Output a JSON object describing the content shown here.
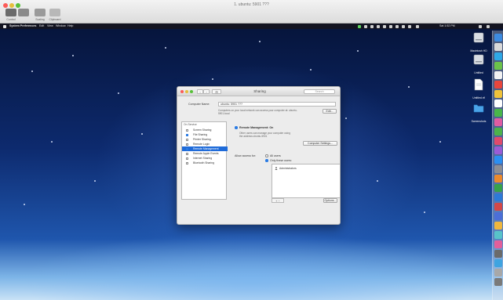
{
  "viewer": {
    "title": "1. ubuntu: 5901 ???",
    "toolbar": {
      "control_label": "Control",
      "scaling_label": "Scaling",
      "clipboard_label": "Clipboard"
    }
  },
  "menubar": {
    "app_name": "System Preferences",
    "menus": [
      "Edit",
      "View",
      "Window",
      "Help"
    ],
    "clock": "Sat 1:52 PM"
  },
  "desktop_items": [
    {
      "label": "Macintosh HD",
      "icon": "hard-drive-icon"
    },
    {
      "label": "Untitled",
      "icon": "hard-drive-icon"
    },
    {
      "label": "Untitled.rtf",
      "icon": "document-icon"
    },
    {
      "label": "Screenshots",
      "icon": "folder-icon"
    }
  ],
  "prefs": {
    "title": "Sharing",
    "search_placeholder": "Search",
    "computer_name_label": "Computer Name:",
    "computer_name_value": "ubuntu: 5901 ???",
    "computer_name_hint": "Computers on your local network can access your computer at: ubuntu-5901.local",
    "edit_button": "Edit...",
    "services_header": "On   Service",
    "services": [
      {
        "name": "Screen Sharing",
        "on": false,
        "selected": false
      },
      {
        "name": "File Sharing",
        "on": true,
        "selected": false
      },
      {
        "name": "Printer Sharing",
        "on": false,
        "selected": false
      },
      {
        "name": "Remote Login",
        "on": false,
        "selected": false
      },
      {
        "name": "Remote Management",
        "on": true,
        "selected": true
      },
      {
        "name": "Remote Apple Events",
        "on": false,
        "selected": false
      },
      {
        "name": "Internet Sharing",
        "on": false,
        "selected": false
      },
      {
        "name": "Bluetooth Sharing",
        "on": false,
        "selected": false
      }
    ],
    "status_title": "Remote Management: On",
    "status_desc": "Other users can manage your computer using the address ubuntu-5901",
    "computer_settings_button": "Computer Settings...",
    "allow_access_label": "Allow access for:",
    "all_users_label": "All users",
    "only_users_label": "Only these users:",
    "users": [
      "Administrators"
    ],
    "options_button": "Options...",
    "plus_minus": "+ −"
  },
  "colors": {
    "accent": "#1f6bd9",
    "close": "#fc5b57",
    "minimize": "#e5bf3c",
    "zoom": "#57c038"
  }
}
